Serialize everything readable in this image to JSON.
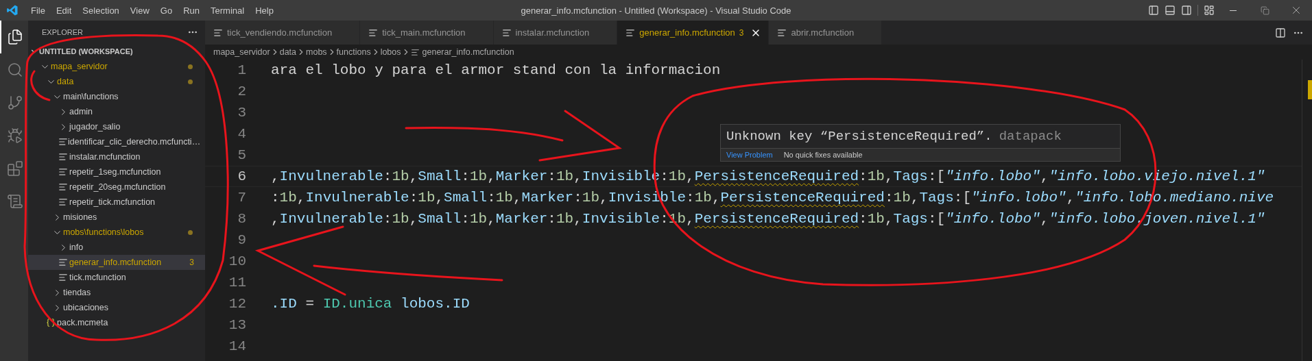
{
  "title_bar": {
    "menus": [
      "File",
      "Edit",
      "Selection",
      "View",
      "Go",
      "Run",
      "Terminal",
      "Help"
    ],
    "title": "generar_info.mcfunction - Untitled (Workspace) - Visual Studio Code"
  },
  "activity_bar": [
    {
      "kind": "explorer",
      "selected": true
    },
    {
      "kind": "search",
      "selected": false
    },
    {
      "kind": "source_control",
      "selected": false
    },
    {
      "kind": "run",
      "selected": false
    },
    {
      "kind": "extensions",
      "selected": false
    },
    {
      "kind": "remote",
      "selected": false
    }
  ],
  "explorer": {
    "title": "EXPLORER",
    "section": "UNTITLED (WORKSPACE)",
    "section_expanded": true,
    "tree": [
      {
        "kind": "folder",
        "label": "mapa_servidor",
        "expanded": true,
        "problem": true,
        "children": [
          {
            "kind": "folder",
            "label": "data",
            "expanded": true,
            "problem": true,
            "children": [
              {
                "kind": "folder",
                "label": "main\\functions",
                "expanded": true,
                "problem": false,
                "children": [
                  {
                    "kind": "folder",
                    "label": "admin",
                    "expanded": false,
                    "problem": false
                  },
                  {
                    "kind": "folder",
                    "label": "jugador_salio",
                    "expanded": false,
                    "problem": false
                  },
                  {
                    "kind": "file",
                    "label": "identificar_clic_derecho.mcfuncti…",
                    "selected": false,
                    "problem": false
                  },
                  {
                    "kind": "file",
                    "label": "instalar.mcfunction",
                    "selected": false,
                    "problem": false
                  },
                  {
                    "kind": "file",
                    "label": "repetir_1seg.mcfunction",
                    "selected": false,
                    "problem": false
                  },
                  {
                    "kind": "file",
                    "label": "repetir_20seg.mcfunction",
                    "selected": false,
                    "problem": false
                  },
                  {
                    "kind": "file",
                    "label": "repetir_tick.mcfunction",
                    "selected": false,
                    "problem": false
                  }
                ]
              },
              {
                "kind": "folder",
                "label": "misiones",
                "expanded": false,
                "problem": false
              },
              {
                "kind": "folder",
                "label": "mobs\\functions\\lobos",
                "expanded": true,
                "problem": true,
                "children": [
                  {
                    "kind": "folder",
                    "label": "info",
                    "expanded": false,
                    "problem": false
                  },
                  {
                    "kind": "file",
                    "label": "generar_info.mcfunction",
                    "selected": true,
                    "problem": true,
                    "badge": "3"
                  },
                  {
                    "kind": "file",
                    "label": "tick.mcfunction",
                    "selected": false,
                    "problem": false
                  }
                ]
              },
              {
                "kind": "folder",
                "label": "tiendas",
                "expanded": false,
                "problem": false
              },
              {
                "kind": "folder",
                "label": "ubicaciones",
                "expanded": false,
                "problem": false
              }
            ]
          },
          {
            "kind": "json",
            "label": "pack.mcmeta",
            "selected": false,
            "problem": false
          }
        ]
      }
    ]
  },
  "tabs": [
    {
      "label": "tick_vendiendo.mcfunction",
      "selected": false,
      "problem": false
    },
    {
      "label": "tick_main.mcfunction",
      "selected": false,
      "problem": false
    },
    {
      "label": "instalar.mcfunction",
      "selected": false,
      "problem": false
    },
    {
      "label": "generar_info.mcfunction",
      "selected": true,
      "problem": true,
      "badge": "3"
    },
    {
      "label": "abrir.mcfunction",
      "selected": false,
      "problem": false
    }
  ],
  "breadcrumb": [
    "mapa_servidor",
    "data",
    "mobs",
    "functions",
    "lobos",
    "generar_info.mcfunction"
  ],
  "lines": [
    {
      "number": "1",
      "current": false,
      "tokens": [
        {
          "kind": "plain",
          "text": "ara el lobo y para el armor stand con la informacion"
        }
      ]
    },
    {
      "number": "2",
      "current": false
    },
    {
      "number": "3",
      "current": false
    },
    {
      "number": "4",
      "current": false
    },
    {
      "number": "5",
      "current": false
    },
    {
      "number": "6",
      "current": true,
      "tokens": [
        {
          "kind": "punct",
          "text": ","
        },
        {
          "kind": "key",
          "text": "Invulnerable"
        },
        {
          "kind": "punct",
          "text": ":"
        },
        {
          "kind": "num",
          "text": "1b"
        },
        {
          "kind": "punct",
          "text": ","
        },
        {
          "kind": "key",
          "text": "Small"
        },
        {
          "kind": "punct",
          "text": ":"
        },
        {
          "kind": "num",
          "text": "1b"
        },
        {
          "kind": "punct",
          "text": ","
        },
        {
          "kind": "key",
          "text": "Marker"
        },
        {
          "kind": "punct",
          "text": ":"
        },
        {
          "kind": "num",
          "text": "1b"
        },
        {
          "kind": "punct",
          "text": ","
        },
        {
          "kind": "key",
          "text": "Invisible"
        },
        {
          "kind": "punct",
          "text": ":"
        },
        {
          "kind": "num",
          "text": "1b"
        },
        {
          "kind": "punct",
          "text": ","
        },
        {
          "kind": "warn",
          "text": "PersistenceRequired"
        },
        {
          "kind": "punct",
          "text": ":"
        },
        {
          "kind": "num",
          "text": "1b"
        },
        {
          "kind": "punct",
          "text": ","
        },
        {
          "kind": "key",
          "text": "Tags"
        },
        {
          "kind": "punct",
          "text": ":["
        },
        {
          "kind": "string",
          "text": "\"info.lobo\""
        },
        {
          "kind": "punct",
          "text": ","
        },
        {
          "kind": "string",
          "text": "\"info.lobo.viejo.nivel.1\""
        }
      ]
    },
    {
      "number": "7",
      "current": false,
      "tokens": [
        {
          "kind": "punct",
          "text": ":"
        },
        {
          "kind": "num",
          "text": "1b"
        },
        {
          "kind": "punct",
          "text": ","
        },
        {
          "kind": "key",
          "text": "Invulnerable"
        },
        {
          "kind": "punct",
          "text": ":"
        },
        {
          "kind": "num",
          "text": "1b"
        },
        {
          "kind": "punct",
          "text": ","
        },
        {
          "kind": "key",
          "text": "Small"
        },
        {
          "kind": "punct",
          "text": ":"
        },
        {
          "kind": "num",
          "text": "1b"
        },
        {
          "kind": "punct",
          "text": ","
        },
        {
          "kind": "key",
          "text": "Marker"
        },
        {
          "kind": "punct",
          "text": ":"
        },
        {
          "kind": "num",
          "text": "1b"
        },
        {
          "kind": "punct",
          "text": ","
        },
        {
          "kind": "key",
          "text": "Invisible"
        },
        {
          "kind": "punct",
          "text": ":"
        },
        {
          "kind": "num",
          "text": "1b"
        },
        {
          "kind": "punct",
          "text": ","
        },
        {
          "kind": "warn",
          "text": "PersistenceRequired"
        },
        {
          "kind": "punct",
          "text": ":"
        },
        {
          "kind": "num",
          "text": "1b"
        },
        {
          "kind": "punct",
          "text": ","
        },
        {
          "kind": "key",
          "text": "Tags"
        },
        {
          "kind": "punct",
          "text": ":["
        },
        {
          "kind": "string",
          "text": "\"info.lobo\""
        },
        {
          "kind": "punct",
          "text": ","
        },
        {
          "kind": "string",
          "text": "\"info.lobo.mediano.nive"
        }
      ]
    },
    {
      "number": "8",
      "current": false,
      "tokens": [
        {
          "kind": "punct",
          "text": ","
        },
        {
          "kind": "key",
          "text": "Invulnerable"
        },
        {
          "kind": "punct",
          "text": ":"
        },
        {
          "kind": "num",
          "text": "1b"
        },
        {
          "kind": "punct",
          "text": ","
        },
        {
          "kind": "key",
          "text": "Small"
        },
        {
          "kind": "punct",
          "text": ":"
        },
        {
          "kind": "num",
          "text": "1b"
        },
        {
          "kind": "punct",
          "text": ","
        },
        {
          "kind": "key",
          "text": "Marker"
        },
        {
          "kind": "punct",
          "text": ":"
        },
        {
          "kind": "num",
          "text": "1b"
        },
        {
          "kind": "punct",
          "text": ","
        },
        {
          "kind": "key",
          "text": "Invisible"
        },
        {
          "kind": "punct",
          "text": ":"
        },
        {
          "kind": "num",
          "text": "1b"
        },
        {
          "kind": "punct",
          "text": ","
        },
        {
          "kind": "warn",
          "text": "PersistenceRequired"
        },
        {
          "kind": "punct",
          "text": ":"
        },
        {
          "kind": "num",
          "text": "1b"
        },
        {
          "kind": "punct",
          "text": ","
        },
        {
          "kind": "key",
          "text": "Tags"
        },
        {
          "kind": "punct",
          "text": ":["
        },
        {
          "kind": "string",
          "text": "\"info.lobo\""
        },
        {
          "kind": "punct",
          "text": ","
        },
        {
          "kind": "string",
          "text": "\"info.lobo.joven.nivel.1\""
        }
      ]
    },
    {
      "number": "9",
      "current": false
    },
    {
      "number": "10",
      "current": false
    },
    {
      "number": "11",
      "current": false
    },
    {
      "number": "12",
      "current": false,
      "tokens": [
        {
          "kind": "key",
          "text": ".ID"
        },
        {
          "kind": "punct",
          "text": " = "
        },
        {
          "kind": "type",
          "text": "ID.unica"
        },
        {
          "kind": "key",
          "text": " lobos.ID"
        }
      ]
    },
    {
      "number": "13",
      "current": false
    },
    {
      "number": "14",
      "current": false
    }
  ],
  "hover": {
    "message": "Unknown key “PersistenceRequired”.",
    "source": "datapack",
    "link": "View Problem",
    "note": "No quick fixes available"
  }
}
